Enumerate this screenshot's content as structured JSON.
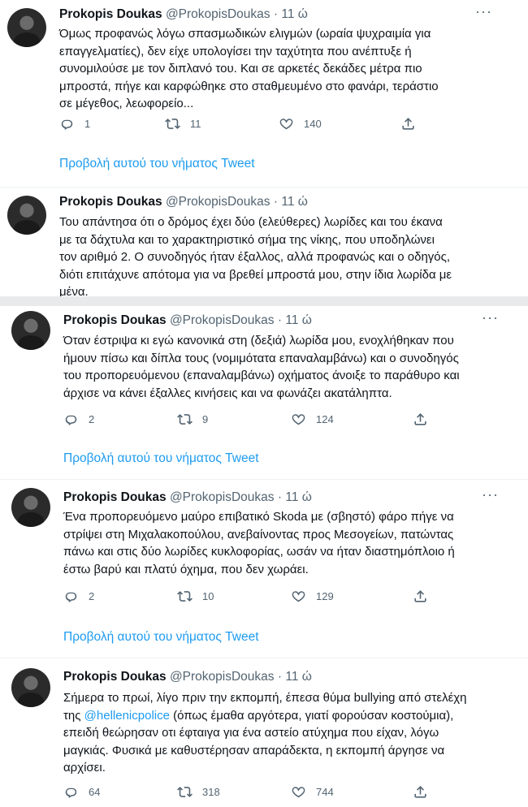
{
  "author": {
    "name": "Prokopis Doukas",
    "handle": "@ProkopisDoukas",
    "dot": "·",
    "time": "11 ώ"
  },
  "more_label": "···",
  "thread_link_label": "Προβολή αυτού του νήματος Tweet",
  "tweets": [
    {
      "lines": [
        "Όμως προφανώς λόγω σπασμωδικών ελιγμών (ωραία ψυχραιμία για",
        "επαγγελματίες), δεν είχε υπολογίσει την ταχύτητα που ανέπτυξε ή",
        "συνομιλούσε με τον διπλανό του. Και σε αρκετές δεκάδες μέτρα πιο",
        "μπροστά, πήγε και καρφώθηκε στο σταθμευμένο στο φανάρι, τεράστιο",
        "σε μέγεθος, λεωφορείο..."
      ],
      "replies": "1",
      "retweets": "11",
      "likes": "140"
    },
    {
      "lines": [
        "Του απάντησα ότι ο δρόμος έχει δύο (ελεύθερες) λωρίδες και του έκανα",
        "με τα δάχτυλα και το χαρακτηριστικό σήμα της νίκης, που υποδηλώνει",
        "τον αριθμό 2. Ο συνοδηγός ήταν έξαλλος, αλλά προφανώς και ο οδηγός,",
        "διότι επιτάχυνε απότομα για να βρεθεί μπροστά μου, στην ίδια λωρίδα με",
        "μένα."
      ]
    },
    {
      "lines": [
        "Όταν έστριψα κι εγώ κανονικά στη (δεξιά) λωρίδα μου, ενοχλήθηκαν που",
        "ήμουν πίσω και δίπλα τους (νομιμότατα επαναλαμβάνω) και ο συνοδηγός",
        "του προπορευόμενου (επαναλαμβάνω) οχήματος άνοιξε το παράθυρο και",
        "άρχισε να κάνει έξαλλες κινήσεις και να φωνάζει ακατάληπτα."
      ],
      "replies": "2",
      "retweets": "9",
      "likes": "124"
    },
    {
      "lines": [
        "Ένα προπορευόμενο μαύρο επιβατικό Skoda με (σβηστό) φάρο πήγε να",
        "στρίψει στη Μιχαλακοπούλου, ανεβαίνοντας προς Μεσογείων, πατώντας",
        "πάνω και στις δύο λωρίδες κυκλοφορίας, ωσάν να ήταν διαστημόπλοιο ή",
        "έστω βαρύ και πλατύ όχημα, που δεν χωράει."
      ],
      "replies": "2",
      "retweets": "10",
      "likes": "129"
    },
    {
      "line1": "Σήμερα το πρωί, λίγο πριν την εκπομπή, έπεσα θύμα bullying από στελέχη",
      "line2_prefix": "της ",
      "mention": "@hellenicpolice",
      "line2_suffix": " (όπως έμαθα αργότερα, γιατί φορούσαν κοστούμια),",
      "line3": "επειδή θεώρησαν οτι έφταιγα για ένα αστείο ατύχημα που είχαν, λόγω",
      "line4": "μαγκιάς. Φυσικά με καθυστέρησαν απαράδεκτα, η εκπομπή άργησε να",
      "line5": "αρχίσει.",
      "replies": "64",
      "retweets": "318",
      "likes": "744"
    }
  ],
  "icons": [
    "reply-icon",
    "retweet-icon",
    "like-icon",
    "share-icon",
    "more-icon"
  ],
  "colors": {
    "link": "#1d9bf0",
    "secondary": "#536471",
    "text": "#0f1419"
  }
}
